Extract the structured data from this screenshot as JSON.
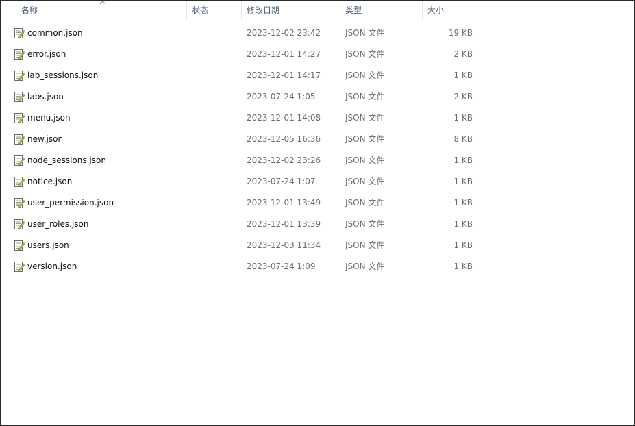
{
  "columns": {
    "name": "名称",
    "status": "状态",
    "date": "修改日期",
    "type": "类型",
    "size": "大小"
  },
  "files": [
    {
      "name": "common.json",
      "date": "2023-12-02 23:42",
      "type": "JSON 文件",
      "size": "19 KB"
    },
    {
      "name": "error.json",
      "date": "2023-12-01 14:27",
      "type": "JSON 文件",
      "size": "2 KB"
    },
    {
      "name": "lab_sessions.json",
      "date": "2023-12-01 14:17",
      "type": "JSON 文件",
      "size": "1 KB"
    },
    {
      "name": "labs.json",
      "date": "2023-07-24 1:05",
      "type": "JSON 文件",
      "size": "2 KB"
    },
    {
      "name": "menu.json",
      "date": "2023-12-01 14:08",
      "type": "JSON 文件",
      "size": "1 KB"
    },
    {
      "name": "new.json",
      "date": "2023-12-05 16:36",
      "type": "JSON 文件",
      "size": "8 KB"
    },
    {
      "name": "node_sessions.json",
      "date": "2023-12-02 23:26",
      "type": "JSON 文件",
      "size": "1 KB"
    },
    {
      "name": "notice.json",
      "date": "2023-07-24 1:07",
      "type": "JSON 文件",
      "size": "1 KB"
    },
    {
      "name": "user_permission.json",
      "date": "2023-12-01 13:49",
      "type": "JSON 文件",
      "size": "1 KB"
    },
    {
      "name": "user_roles.json",
      "date": "2023-12-01 13:39",
      "type": "JSON 文件",
      "size": "1 KB"
    },
    {
      "name": "users.json",
      "date": "2023-12-03 11:34",
      "type": "JSON 文件",
      "size": "1 KB"
    },
    {
      "name": "version.json",
      "date": "2023-07-24 1:09",
      "type": "JSON 文件",
      "size": "1 KB"
    }
  ]
}
